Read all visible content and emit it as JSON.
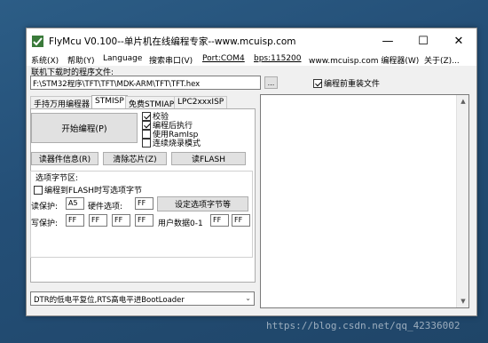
{
  "window": {
    "title": "FlyMcu V0.100--单片机在线编程专家--www.mcuisp.com",
    "controls": {
      "minimize": "—",
      "maximize": "☐",
      "close": "✕"
    }
  },
  "menu": {
    "items": [
      "系统(X)",
      "帮助(Y)",
      "Language",
      "搜索串口(V)",
      "Port:COM4",
      "bps:115200",
      "www.mcuisp.com 编程器(W)",
      "关于(Z)..."
    ]
  },
  "file": {
    "label": "联机下载时的程序文件:",
    "path": "F:\\STM32程序\\TFT\\TFT\\MDK-ARM\\TFT\\TFT.hex",
    "browse": "...",
    "reload_label": "编程前重装文件",
    "reload_checked": true
  },
  "tabs": [
    "手持万用编程器",
    "STMISP",
    "免费STMIAP",
    "LPC2xxxISP"
  ],
  "active_tab": "STMISP",
  "program": {
    "start_button": "开始编程(P)",
    "options": [
      {
        "label": "校验",
        "checked": true
      },
      {
        "label": "编程后执行",
        "checked": true
      },
      {
        "label": "使用RamIsp",
        "checked": false
      },
      {
        "label": "连续烧录模式",
        "checked": false
      }
    ]
  },
  "actions": {
    "read_info": "读器件信息(R)",
    "erase": "清除芯片(Z)",
    "read_flash": "读FLASH"
  },
  "option_bytes": {
    "group_label": "选项字节区:",
    "write_when_program": "编程到FLASH时写选项字节",
    "read_protect_label": "读保护:",
    "read_protect_value": "A5",
    "hw_option_label": "硬件选项:",
    "hw_option_value": "FF",
    "set_button": "设定选项字节等",
    "write_protect_label": "写保护:",
    "write_protect_values": [
      "FF",
      "FF",
      "FF",
      "FF"
    ],
    "user_data_label": "用户数据0-1",
    "user_data_values": [
      "FF",
      "FF"
    ]
  },
  "reset_mode": {
    "selected": "DTR的低电平复位,RTS高电平进BootLoader"
  },
  "watermark": "https://blog.csdn.net/qq_42336002"
}
